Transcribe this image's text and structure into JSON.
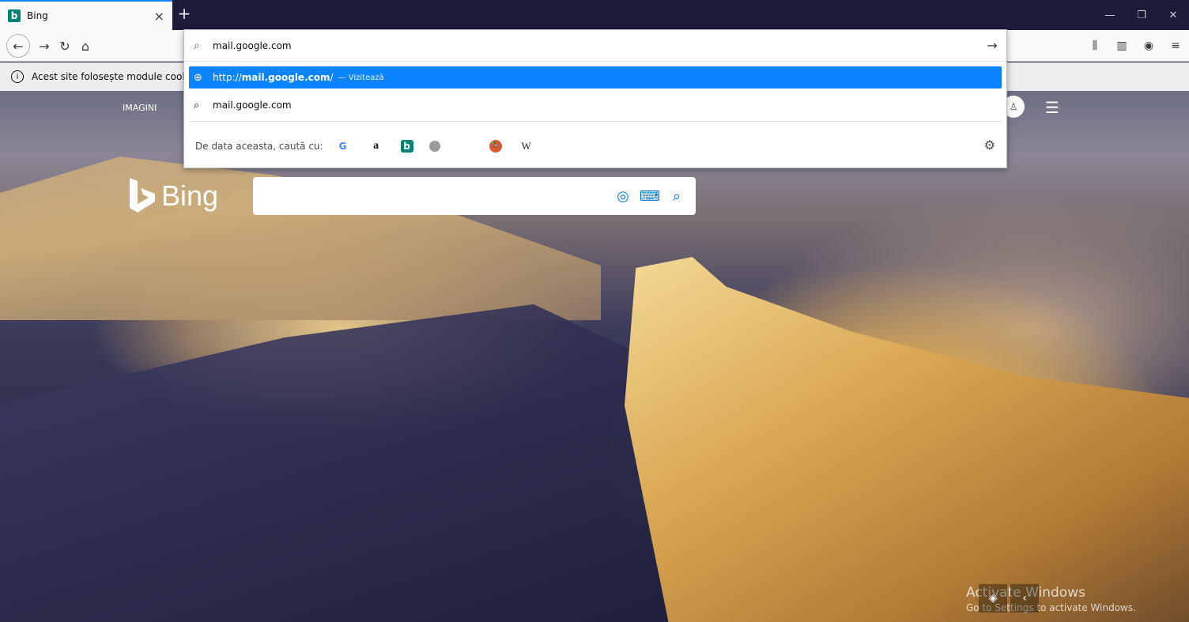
{
  "tab": {
    "title": "Bing",
    "favicon_letter": "b"
  },
  "address": {
    "value": "mail.google.com",
    "suggestions": [
      {
        "url_prefix": "http://",
        "url_bold": "mail.google.com",
        "url_suffix": "/",
        "action": "— Vizitează"
      },
      {
        "text": "mail.google.com"
      }
    ],
    "search_with_label": "De data aceasta, caută cu:",
    "engines": [
      "G",
      "a",
      "b",
      "",
      "",
      "W"
    ]
  },
  "notification": {
    "text": "Acest site folosește module cooki"
  },
  "bing": {
    "logo_text": "Bing",
    "nav_item": "IMAGINI"
  },
  "watermark": {
    "line1": "Activate Windows",
    "line2": "Go to Settings to activate Windows."
  },
  "colors": {
    "accent": "#0a84ff",
    "bing_brand": "#008373"
  }
}
